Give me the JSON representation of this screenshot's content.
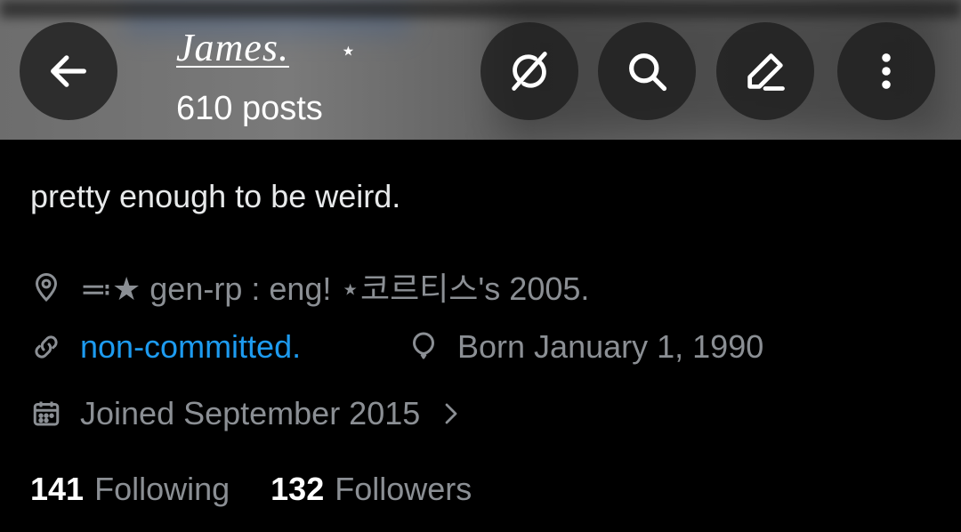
{
  "header": {
    "display_name": "James.",
    "name_suffix": "⋆",
    "post_count": "610 posts"
  },
  "icons": {
    "back": "arrow-left-icon",
    "grok": "grok-icon",
    "search": "search-icon",
    "edit": "pen-icon",
    "more": "more-vertical-icon",
    "location": "location-pin-icon",
    "link": "link-icon",
    "birthday": "balloon-icon",
    "joined": "calendar-icon",
    "chevron": "chevron-right-icon"
  },
  "profile": {
    "bio": "pretty enough to be weird.",
    "location": "≕★ gen-rp : eng! ⋆코르티스's 2005.",
    "website": "non-committed.",
    "birthday": "Born January 1, 1990",
    "joined": "Joined September 2015"
  },
  "stats": {
    "following_count": "141",
    "following_label": "Following",
    "followers_count": "132",
    "followers_label": "Followers"
  },
  "colors": {
    "background": "#000000",
    "secondary_text": "#8b8f94",
    "link": "#1d9bf0",
    "primary_text": "#e7e9ea"
  }
}
